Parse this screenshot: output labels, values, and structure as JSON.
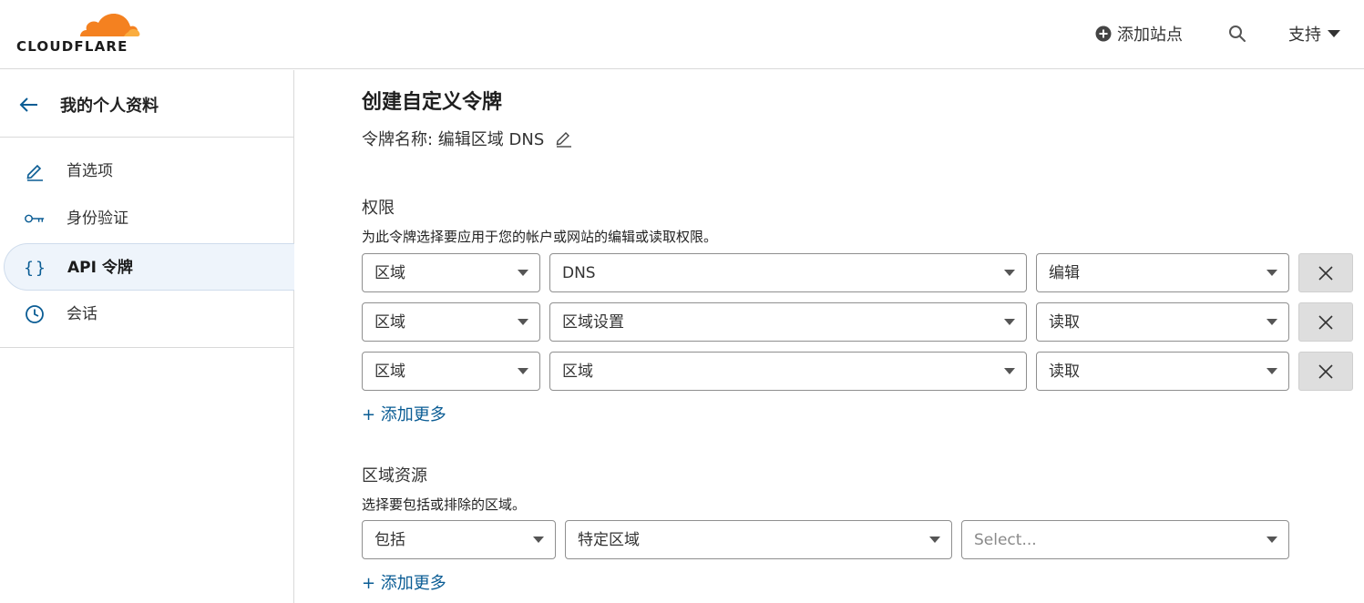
{
  "brand": {
    "logo_text": "CLOUDFLARE",
    "orange": "#f48120",
    "light_orange": "#faad3f"
  },
  "header": {
    "add_site_label": "添加站点",
    "support_label": "支持"
  },
  "sidebar": {
    "title": "我的个人资料",
    "items": [
      {
        "label": "首选项",
        "icon": "pencil-icon",
        "active": false
      },
      {
        "label": "身份验证",
        "icon": "key-icon",
        "active": false
      },
      {
        "label": "API 令牌",
        "icon": "braces-icon",
        "active": true
      },
      {
        "label": "会话",
        "icon": "clock-icon",
        "active": false
      }
    ]
  },
  "main": {
    "title": "创建自定义令牌",
    "token_name_label": "令牌名称: 编辑区域 DNS",
    "permissions": {
      "title": "权限",
      "description": "为此令牌选择要应用于您的帐户或网站的编辑或读取权限。",
      "rows": [
        {
          "scope": "区域",
          "resource": "DNS",
          "access": "编辑"
        },
        {
          "scope": "区域",
          "resource": "区域设置",
          "access": "读取"
        },
        {
          "scope": "区域",
          "resource": "区域",
          "access": "读取"
        }
      ],
      "add_more": "+ 添加更多"
    },
    "zone_resources": {
      "title": "区域资源",
      "description": "选择要包括或排除的区域。",
      "include": "包括",
      "type": "特定区域",
      "zone_placeholder": "Select...",
      "add_more": "+ 添加更多"
    }
  },
  "colors": {
    "link": "#0a5c94",
    "active_bg": "#eef4fb",
    "border": "#d9d9d9"
  }
}
